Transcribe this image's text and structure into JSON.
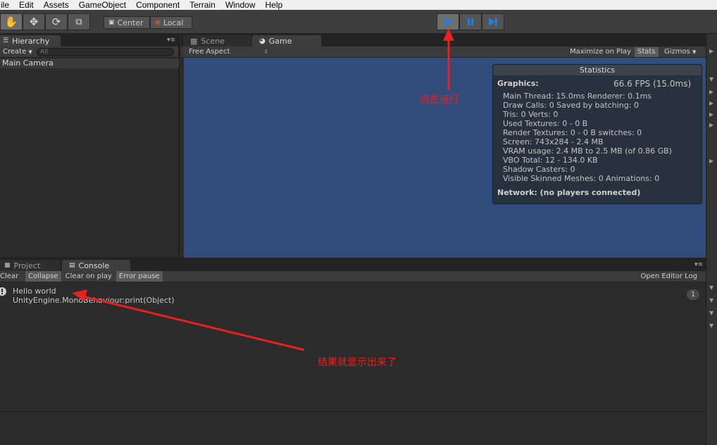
{
  "menu": [
    "ile",
    "Edit",
    "Assets",
    "GameObject",
    "Component",
    "Terrain",
    "Window",
    "Help"
  ],
  "toolbar": {
    "tools": [
      "hand-tool-icon",
      "move-tool-icon",
      "rotate-tool-icon",
      "scale-tool-icon"
    ],
    "pivot_center": "Center",
    "pivot_local": "Local",
    "play_controls": [
      "play-icon",
      "pause-icon",
      "step-icon"
    ],
    "accent": "#1f7fe0"
  },
  "hierarchy": {
    "tab": "Hierarchy",
    "create": "Create",
    "search_placeholder": "All",
    "items": [
      "Main Camera"
    ]
  },
  "scene": {
    "tabs": [
      "Scene",
      "Game"
    ],
    "aspect": "Free Aspect",
    "maximize": "Maximize on Play",
    "stats": "Stats",
    "gizmos": "Gizmos",
    "background": "#314d7c"
  },
  "statistics": {
    "title": "Statistics",
    "graphics_label": "Graphics:",
    "fps": "66.6 FPS (15.0ms)",
    "lines": [
      "Main Thread: 15.0ms  Renderer: 0.1ms",
      "Draw Calls: 0   Saved by batching: 0",
      "Tris: 0      Verts: 0",
      "Used Textures: 0 - 0 B",
      "Render Textures: 0 - 0 B  switches: 0",
      "Screen: 743x284 - 2.4 MB",
      "VRAM usage: 2.4 MB to 2.5 MB (of 0.86 GB)",
      "VBO Total: 12 - 134.0 KB",
      "Shadow Casters: 0",
      "Visible Skinned Meshes: 0      Animations: 0"
    ],
    "network": "Network: (no players connected)"
  },
  "console": {
    "tabs": [
      "Project",
      "Console"
    ],
    "buttons": [
      "Clear",
      "Collapse",
      "Clear on play",
      "Error pause"
    ],
    "open_log": "Open Editor Log",
    "entry_message": "Hello world",
    "entry_stack": "UnityEngine.MonoBehaviour:print(Object)",
    "count": "1"
  },
  "annotations": {
    "play_note": "点击运行",
    "result_note": "结果就显示出来了",
    "color": "#e8201e"
  }
}
